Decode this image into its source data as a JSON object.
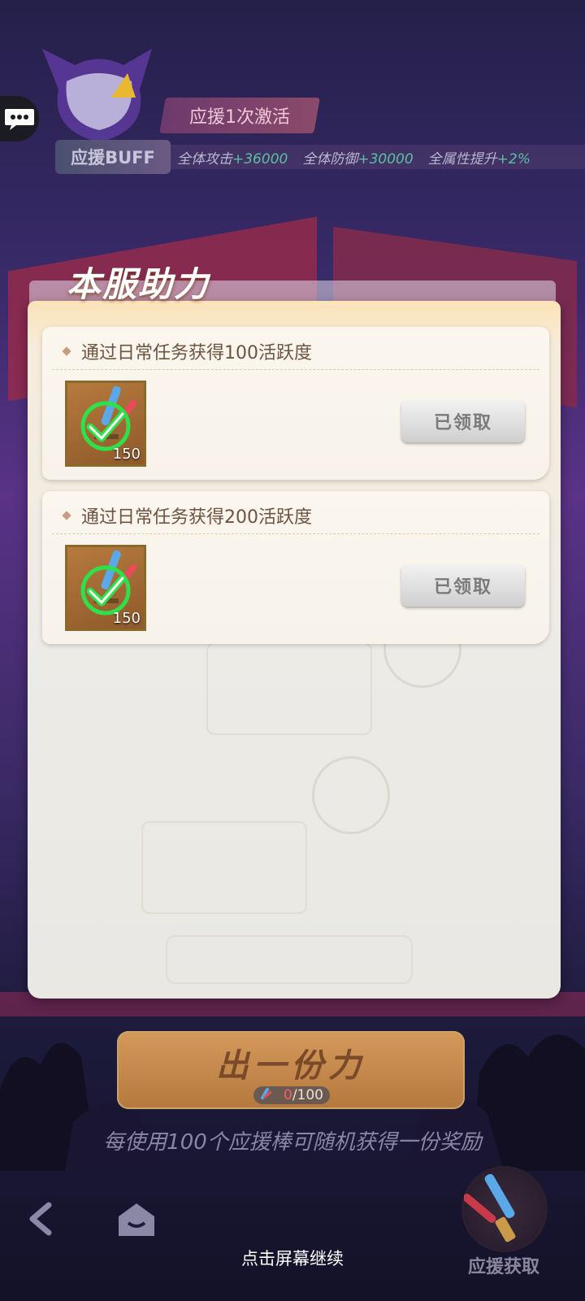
{
  "buff": {
    "activation_title": "应援1次激活",
    "label": "应援BUFF",
    "stats": [
      {
        "name": "全体攻击",
        "value": "+36000"
      },
      {
        "name": "全体防御",
        "value": "+30000"
      },
      {
        "name": "全属性提升",
        "value": "+2%"
      }
    ]
  },
  "panel": {
    "title": "本服助力",
    "tasks": [
      {
        "title": "通过日常任务获得100活跃度",
        "item_count": "150",
        "button": "已领取"
      },
      {
        "title": "通过日常任务获得200活跃度",
        "item_count": "150",
        "button": "已领取"
      }
    ]
  },
  "bottom": {
    "contribute_label": "出一份力",
    "progress_current": "0",
    "progress_total": "/100",
    "hint": "每使用100个应援棒可随机获得一份奖励",
    "continue_text": "点击屏幕继续",
    "support_label": "应援获取"
  }
}
